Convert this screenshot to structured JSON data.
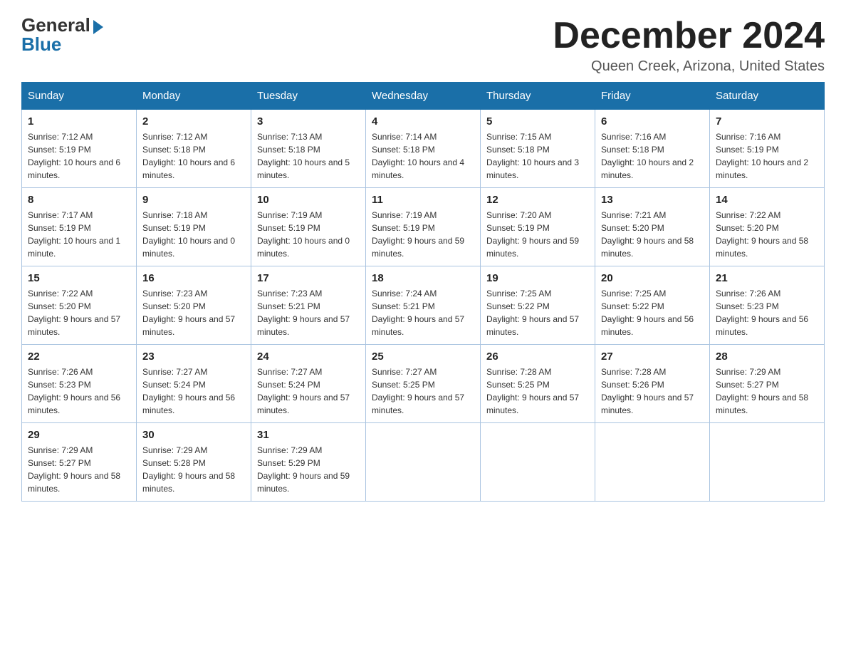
{
  "logo": {
    "general": "General",
    "blue": "Blue"
  },
  "title": "December 2024",
  "subtitle": "Queen Creek, Arizona, United States",
  "days_of_week": [
    "Sunday",
    "Monday",
    "Tuesday",
    "Wednesday",
    "Thursday",
    "Friday",
    "Saturday"
  ],
  "weeks": [
    [
      {
        "day": "1",
        "sunrise": "7:12 AM",
        "sunset": "5:19 PM",
        "daylight": "10 hours and 6 minutes."
      },
      {
        "day": "2",
        "sunrise": "7:12 AM",
        "sunset": "5:18 PM",
        "daylight": "10 hours and 6 minutes."
      },
      {
        "day": "3",
        "sunrise": "7:13 AM",
        "sunset": "5:18 PM",
        "daylight": "10 hours and 5 minutes."
      },
      {
        "day": "4",
        "sunrise": "7:14 AM",
        "sunset": "5:18 PM",
        "daylight": "10 hours and 4 minutes."
      },
      {
        "day": "5",
        "sunrise": "7:15 AM",
        "sunset": "5:18 PM",
        "daylight": "10 hours and 3 minutes."
      },
      {
        "day": "6",
        "sunrise": "7:16 AM",
        "sunset": "5:18 PM",
        "daylight": "10 hours and 2 minutes."
      },
      {
        "day": "7",
        "sunrise": "7:16 AM",
        "sunset": "5:19 PM",
        "daylight": "10 hours and 2 minutes."
      }
    ],
    [
      {
        "day": "8",
        "sunrise": "7:17 AM",
        "sunset": "5:19 PM",
        "daylight": "10 hours and 1 minute."
      },
      {
        "day": "9",
        "sunrise": "7:18 AM",
        "sunset": "5:19 PM",
        "daylight": "10 hours and 0 minutes."
      },
      {
        "day": "10",
        "sunrise": "7:19 AM",
        "sunset": "5:19 PM",
        "daylight": "10 hours and 0 minutes."
      },
      {
        "day": "11",
        "sunrise": "7:19 AM",
        "sunset": "5:19 PM",
        "daylight": "9 hours and 59 minutes."
      },
      {
        "day": "12",
        "sunrise": "7:20 AM",
        "sunset": "5:19 PM",
        "daylight": "9 hours and 59 minutes."
      },
      {
        "day": "13",
        "sunrise": "7:21 AM",
        "sunset": "5:20 PM",
        "daylight": "9 hours and 58 minutes."
      },
      {
        "day": "14",
        "sunrise": "7:22 AM",
        "sunset": "5:20 PM",
        "daylight": "9 hours and 58 minutes."
      }
    ],
    [
      {
        "day": "15",
        "sunrise": "7:22 AM",
        "sunset": "5:20 PM",
        "daylight": "9 hours and 57 minutes."
      },
      {
        "day": "16",
        "sunrise": "7:23 AM",
        "sunset": "5:20 PM",
        "daylight": "9 hours and 57 minutes."
      },
      {
        "day": "17",
        "sunrise": "7:23 AM",
        "sunset": "5:21 PM",
        "daylight": "9 hours and 57 minutes."
      },
      {
        "day": "18",
        "sunrise": "7:24 AM",
        "sunset": "5:21 PM",
        "daylight": "9 hours and 57 minutes."
      },
      {
        "day": "19",
        "sunrise": "7:25 AM",
        "sunset": "5:22 PM",
        "daylight": "9 hours and 57 minutes."
      },
      {
        "day": "20",
        "sunrise": "7:25 AM",
        "sunset": "5:22 PM",
        "daylight": "9 hours and 56 minutes."
      },
      {
        "day": "21",
        "sunrise": "7:26 AM",
        "sunset": "5:23 PM",
        "daylight": "9 hours and 56 minutes."
      }
    ],
    [
      {
        "day": "22",
        "sunrise": "7:26 AM",
        "sunset": "5:23 PM",
        "daylight": "9 hours and 56 minutes."
      },
      {
        "day": "23",
        "sunrise": "7:27 AM",
        "sunset": "5:24 PM",
        "daylight": "9 hours and 56 minutes."
      },
      {
        "day": "24",
        "sunrise": "7:27 AM",
        "sunset": "5:24 PM",
        "daylight": "9 hours and 57 minutes."
      },
      {
        "day": "25",
        "sunrise": "7:27 AM",
        "sunset": "5:25 PM",
        "daylight": "9 hours and 57 minutes."
      },
      {
        "day": "26",
        "sunrise": "7:28 AM",
        "sunset": "5:25 PM",
        "daylight": "9 hours and 57 minutes."
      },
      {
        "day": "27",
        "sunrise": "7:28 AM",
        "sunset": "5:26 PM",
        "daylight": "9 hours and 57 minutes."
      },
      {
        "day": "28",
        "sunrise": "7:29 AM",
        "sunset": "5:27 PM",
        "daylight": "9 hours and 58 minutes."
      }
    ],
    [
      {
        "day": "29",
        "sunrise": "7:29 AM",
        "sunset": "5:27 PM",
        "daylight": "9 hours and 58 minutes."
      },
      {
        "day": "30",
        "sunrise": "7:29 AM",
        "sunset": "5:28 PM",
        "daylight": "9 hours and 58 minutes."
      },
      {
        "day": "31",
        "sunrise": "7:29 AM",
        "sunset": "5:29 PM",
        "daylight": "9 hours and 59 minutes."
      },
      null,
      null,
      null,
      null
    ]
  ]
}
